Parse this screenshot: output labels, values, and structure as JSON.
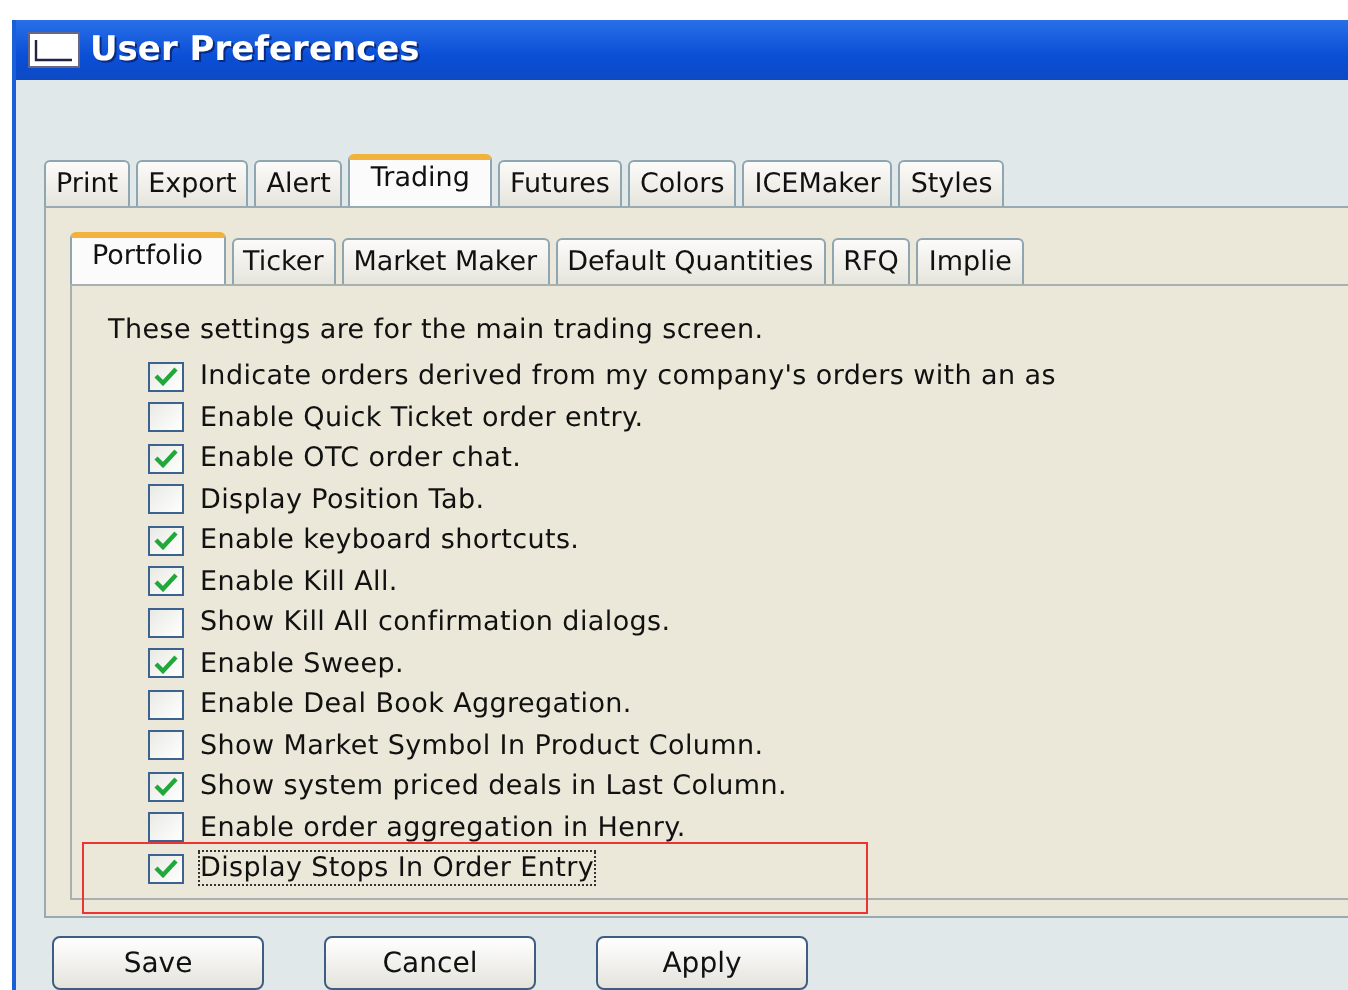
{
  "window": {
    "title": "User Preferences"
  },
  "tabs": [
    {
      "label": "Print",
      "selected": false
    },
    {
      "label": "Export",
      "selected": false
    },
    {
      "label": "Alert",
      "selected": false
    },
    {
      "label": "Trading",
      "selected": true
    },
    {
      "label": "Futures",
      "selected": false
    },
    {
      "label": "Colors",
      "selected": false
    },
    {
      "label": "ICEMaker",
      "selected": false
    },
    {
      "label": "Styles",
      "selected": false
    }
  ],
  "subtabs": [
    {
      "label": "Portfolio",
      "selected": true
    },
    {
      "label": "Ticker",
      "selected": false
    },
    {
      "label": "Market Maker",
      "selected": false
    },
    {
      "label": "Default Quantities",
      "selected": false
    },
    {
      "label": "RFQ",
      "selected": false
    },
    {
      "label": "Implie",
      "selected": false
    }
  ],
  "intro": "These settings are for the main trading screen.",
  "options": [
    {
      "label": "Indicate orders derived from my company's orders with an as",
      "checked": true,
      "highlighted": false
    },
    {
      "label": "Enable Quick Ticket order entry.",
      "checked": false,
      "highlighted": false
    },
    {
      "label": "Enable OTC order chat.",
      "checked": true,
      "highlighted": false
    },
    {
      "label": "Display Position Tab.",
      "checked": false,
      "highlighted": false
    },
    {
      "label": "Enable keyboard shortcuts.",
      "checked": true,
      "highlighted": false
    },
    {
      "label": "Enable Kill All.",
      "checked": true,
      "highlighted": false
    },
    {
      "label": "Show Kill All confirmation dialogs.",
      "checked": false,
      "highlighted": false
    },
    {
      "label": "Enable Sweep.",
      "checked": true,
      "highlighted": false
    },
    {
      "label": "Enable Deal Book Aggregation.",
      "checked": false,
      "highlighted": false
    },
    {
      "label": "Show Market Symbol In Product Column.",
      "checked": false,
      "highlighted": false
    },
    {
      "label": "Show system priced deals in Last Column.",
      "checked": true,
      "highlighted": false
    },
    {
      "label": "Enable order aggregation in Henry.",
      "checked": false,
      "highlighted": false
    },
    {
      "label": "Display Stops In Order Entry",
      "checked": true,
      "highlighted": true
    }
  ],
  "buttons": [
    "Save",
    "Cancel",
    "Apply"
  ]
}
